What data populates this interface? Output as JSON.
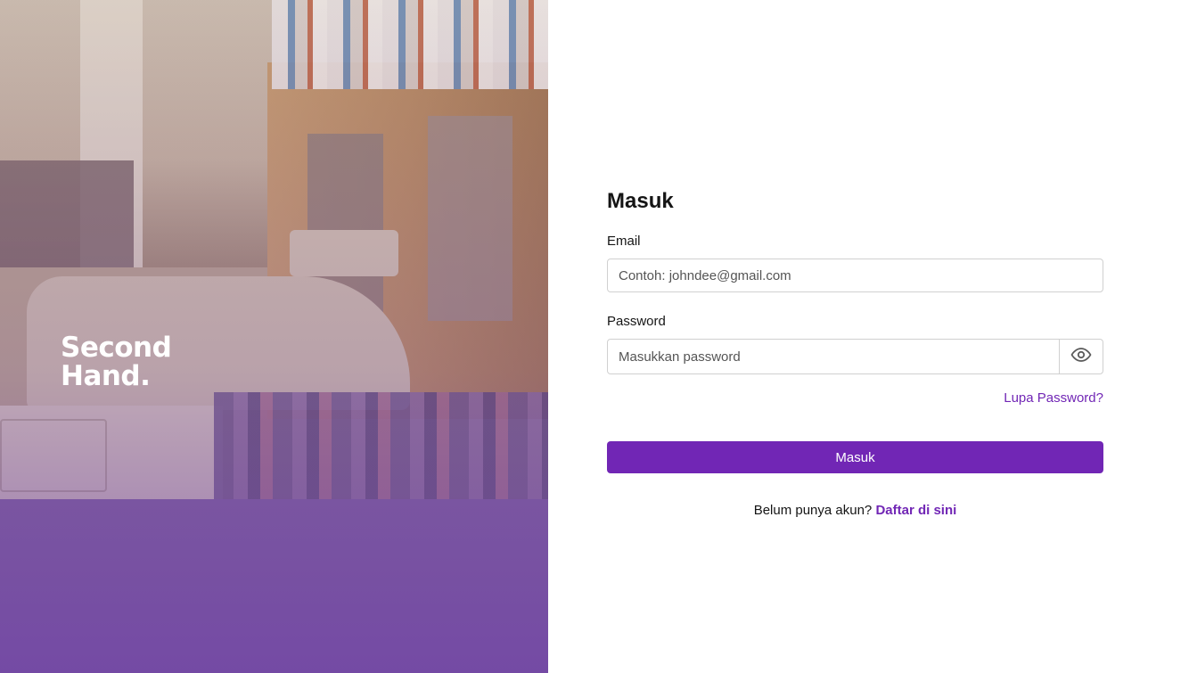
{
  "brand": {
    "line1": "Second",
    "line2": "Hand."
  },
  "form": {
    "title": "Masuk",
    "email_label": "Email",
    "email_placeholder": "Contoh: johndee@gmail.com",
    "password_label": "Password",
    "password_placeholder": "Masukkan password",
    "password_toggle_icon": "eye-icon",
    "forgot_label": "Lupa Password?",
    "submit_label": "Masuk",
    "register_prompt": "Belum punya akun?",
    "register_link": "Daftar di sini"
  },
  "colors": {
    "accent": "#7126b5",
    "text": "#151515",
    "border": "#d0d0d0"
  }
}
